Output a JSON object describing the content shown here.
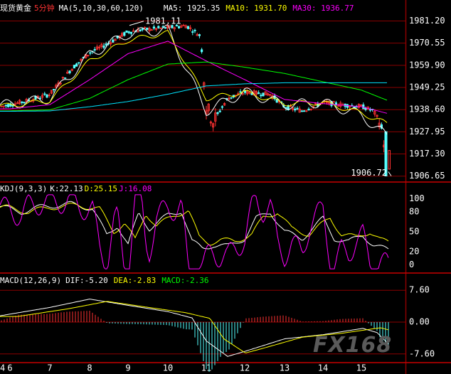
{
  "main_header": {
    "instrument": "现货黄金",
    "period": "5分钟",
    "ma_params": "MA(5,10,30,60,120)",
    "ma5": "MA5: 1925.35",
    "ma10": "MA10: 1931.70",
    "ma30": "MA30: 1936.77"
  },
  "kdj_header": {
    "name": "KDJ(9,3,3)",
    "k": "K:22.13",
    "d": "D:25.15",
    "j": "J:16.08"
  },
  "macd_header": {
    "name": "MACD(12,26,9)",
    "dif": "DIF:-5.20",
    "dea": "DEA:-2.83",
    "macd": "MACD:-2.36"
  },
  "watermark": "FX168",
  "colors": {
    "up": "#ff3232",
    "down": "#54ffff",
    "ma5": "#ffffff",
    "ma10": "#ffff00",
    "ma30": "#ff00ff",
    "ma60": "#00ff00",
    "ma120": "#00e5ff",
    "grid": "#8b0000",
    "axis_text": "#ffffff"
  },
  "chart_data": [
    {
      "type": "candlestick",
      "title": "现货黄金 5分钟",
      "ylim": [
        1904.5,
        1986.5
      ],
      "y_ticks": [
        "1981.20",
        "1970.55",
        "1959.90",
        "1949.25",
        "1938.60",
        "1927.95",
        "1917.30",
        "1906.65"
      ],
      "x_ticks": [
        "6",
        "7",
        "8",
        "9",
        "10",
        "11",
        "12",
        "13",
        "14",
        "15"
      ],
      "x_first_tick_partial": "4",
      "annotations": [
        {
          "label": "1981.11",
          "day": "9",
          "value": 1981.11
        },
        {
          "label": "1906.72",
          "day": "15",
          "value": 1906.72
        }
      ],
      "series": [
        {
          "name": "MA5",
          "last": 1925.35,
          "values_by_day": [
            [
              "6",
              1941.0
            ],
            [
              "7",
              1944.0
            ],
            [
              "8",
              1965.0
            ],
            [
              "9",
              1975.0
            ],
            [
              "10",
              1977.0
            ],
            [
              "11",
              1938.0
            ],
            [
              "12",
              1947.0
            ],
            [
              "13",
              1941.0
            ],
            [
              "14",
              1942.0
            ],
            [
              "15",
              1936.0
            ],
            [
              "15end",
              1925.35
            ]
          ]
        },
        {
          "name": "MA10",
          "last": 1931.7,
          "values_by_day": [
            [
              "6",
              1940.5
            ],
            [
              "7",
              1943.0
            ],
            [
              "8",
              1962.0
            ],
            [
              "9",
              1972.0
            ],
            [
              "10",
              1975.5
            ],
            [
              "11",
              1944.0
            ],
            [
              "12",
              1947.0
            ],
            [
              "13",
              1941.5
            ],
            [
              "14",
              1942.0
            ],
            [
              "15",
              1937.0
            ],
            [
              "15end",
              1931.7
            ]
          ]
        },
        {
          "name": "MA30",
          "last": 1936.77,
          "values_by_day": [
            [
              "6",
              1939.0
            ],
            [
              "7",
              1941.0
            ],
            [
              "8",
              1953.0
            ],
            [
              "9",
              1965.5
            ],
            [
              "10",
              1971.5
            ],
            [
              "11",
              1962.0
            ],
            [
              "12",
              1953.0
            ],
            [
              "13",
              1943.5
            ],
            [
              "14",
              1941.5
            ],
            [
              "15",
              1940.0
            ],
            [
              "15end",
              1936.77
            ]
          ]
        },
        {
          "name": "MA60",
          "values_by_day": [
            [
              "6",
              1938.0
            ],
            [
              "7",
              1938.5
            ],
            [
              "8",
              1944.0
            ],
            [
              "9",
              1953.0
            ],
            [
              "10",
              1960.5
            ],
            [
              "11",
              1961.5
            ],
            [
              "12",
              1959.0
            ],
            [
              "13",
              1956.0
            ],
            [
              "14",
              1952.0
            ],
            [
              "15",
              1948.0
            ],
            [
              "15end",
              1943.0
            ]
          ]
        },
        {
          "name": "MA120",
          "values_by_day": [
            [
              "6",
              1937.8
            ],
            [
              "7",
              1938.0
            ],
            [
              "8",
              1940.0
            ],
            [
              "9",
              1942.5
            ],
            [
              "10",
              1946.0
            ],
            [
              "11",
              1950.0
            ],
            [
              "12",
              1951.0
            ],
            [
              "13",
              1951.5
            ],
            [
              "14",
              1951.5
            ],
            [
              "15",
              1951.5
            ],
            [
              "15end",
              1951.5
            ]
          ]
        }
      ]
    },
    {
      "type": "line",
      "title": "KDJ(9,3,3)",
      "ylim": [
        -8,
        108
      ],
      "y_ticks": [
        "100",
        "80",
        "50",
        "20",
        "0"
      ],
      "series": [
        {
          "name": "K",
          "last": 22.13
        },
        {
          "name": "D",
          "last": 25.15
        },
        {
          "name": "J",
          "last": 16.08
        }
      ]
    },
    {
      "type": "bar",
      "title": "MACD(12,26,9)",
      "ylim": [
        -9,
        9
      ],
      "y_ticks": [
        "7.60",
        "0.00",
        "-7.60"
      ],
      "series": [
        {
          "name": "DIF",
          "last": -5.2
        },
        {
          "name": "DEA",
          "last": -2.83
        },
        {
          "name": "MACD",
          "last": -2.36
        }
      ]
    }
  ]
}
